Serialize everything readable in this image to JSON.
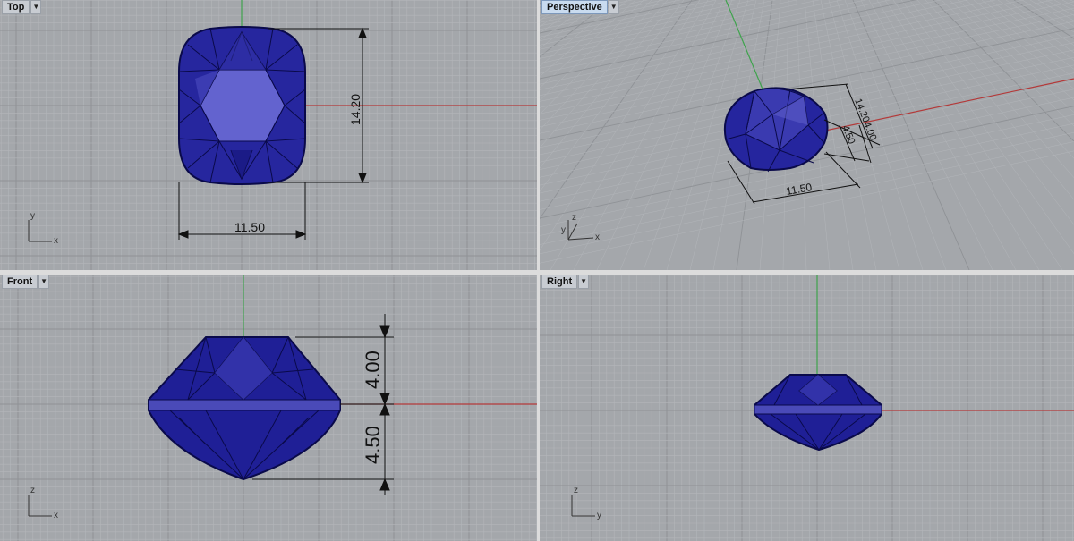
{
  "viewports": {
    "top": {
      "label": "Top"
    },
    "persp": {
      "label": "Perspective"
    },
    "front": {
      "label": "Front"
    },
    "right": {
      "label": "Right"
    }
  },
  "dims": {
    "top_width": "11.50",
    "top_height": "14.20",
    "persp_length": "11.50",
    "persp_width": "14.20",
    "persp_crown": "4.00",
    "persp_pav": "4.50",
    "front_crown": "4.00",
    "front_pav": "4.50"
  },
  "axes": {
    "top": {
      "a": "y",
      "b": "x"
    },
    "persp": {
      "a": "z",
      "b": "y",
      "c": "x"
    },
    "front": {
      "a": "z",
      "b": "x"
    },
    "right": {
      "a": "z",
      "b": "y"
    }
  },
  "colors": {
    "viewport_bg": "#a4a7ab",
    "grid_minor": "#b3b6ba",
    "grid_major": "#8f9296",
    "x_axis": "#b33a3a",
    "y_axis": "#3fa34d",
    "gem_fill": "#1f1f9a",
    "gem_edge": "#0a0a4a",
    "gem_highlight": "#6f6fd6"
  }
}
